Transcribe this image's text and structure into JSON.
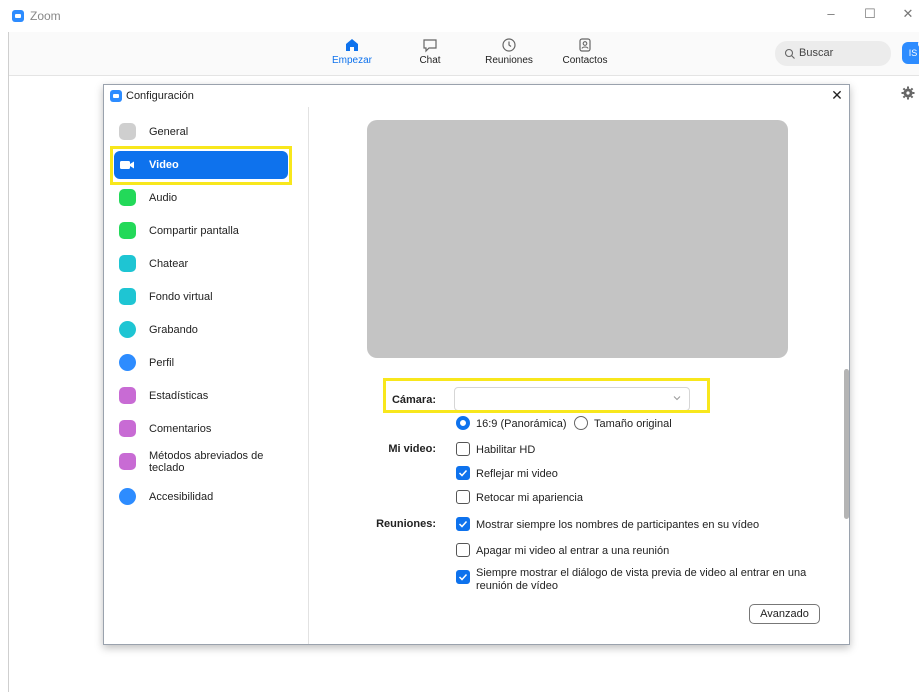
{
  "app": {
    "title": "Zoom"
  },
  "window_controls": {
    "minimize": "–",
    "maximize": "☐",
    "close": "✕"
  },
  "topnav": {
    "items": [
      {
        "label": "Empezar",
        "icon": "home-icon",
        "active": true
      },
      {
        "label": "Chat",
        "icon": "chat-icon"
      },
      {
        "label": "Reuniones",
        "icon": "clock-icon"
      },
      {
        "label": "Contactos",
        "icon": "contacts-icon"
      }
    ],
    "search_placeholder": "Buscar",
    "avatar_initials": "IS"
  },
  "dialog": {
    "title": "Configuración",
    "close": "✕",
    "sidebar": [
      {
        "label": "General",
        "icon": "gear-icon",
        "color": "#c8c8c8"
      },
      {
        "label": "Video",
        "icon": "video-camera-icon",
        "color": "#ffffff",
        "active": true
      },
      {
        "label": "Audio",
        "icon": "headphones-icon",
        "color": "#23d959"
      },
      {
        "label": "Compartir pantalla",
        "icon": "share-screen-icon",
        "color": "#23d959"
      },
      {
        "label": "Chatear",
        "icon": "chat-bubble-icon",
        "color": "#1ec5d3"
      },
      {
        "label": "Fondo virtual",
        "icon": "virtual-background-icon",
        "color": "#1ec5d3"
      },
      {
        "label": "Grabando",
        "icon": "record-icon",
        "color": "#1ec5d3"
      },
      {
        "label": "Perfil",
        "icon": "profile-icon",
        "color": "#2d8cff"
      },
      {
        "label": "Estadísticas",
        "icon": "statistics-icon",
        "color": "#c86bd4"
      },
      {
        "label": "Comentarios",
        "icon": "feedback-icon",
        "color": "#c86bd4"
      },
      {
        "label": "Métodos abreviados de teclado",
        "icon": "keyboard-icon",
        "color": "#c86bd4"
      },
      {
        "label": "Accesibilidad",
        "icon": "accessibility-icon",
        "color": "#2d8cff"
      }
    ],
    "video": {
      "camera_label": "Cámara:",
      "camera_value": "",
      "aspect": {
        "options": [
          {
            "label": "16:9 (Panorámica)",
            "selected": true
          },
          {
            "label": "Tamaño original",
            "selected": false
          }
        ]
      },
      "mi_video_label": "Mi video:",
      "mi_video_options": [
        {
          "label": "Habilitar HD",
          "checked": false
        },
        {
          "label": "Reflejar mi video",
          "checked": true
        },
        {
          "label": "Retocar mi apariencia",
          "checked": false
        }
      ],
      "reuniones_label": "Reuniones:",
      "reuniones_options": [
        {
          "label": "Mostrar siempre los nombres de participantes en su vídeo",
          "checked": true
        },
        {
          "label": "Apagar mi video al entrar a una reunión",
          "checked": false
        },
        {
          "label": "Siempre mostrar el diálogo de vista previa de video al entrar en una reunión de vídeo",
          "checked": true
        }
      ],
      "advanced_button": "Avanzado"
    }
  },
  "colors": {
    "accent": "#0e72ed",
    "highlight": "#f8e71c",
    "preview": "#c4c4c4"
  }
}
